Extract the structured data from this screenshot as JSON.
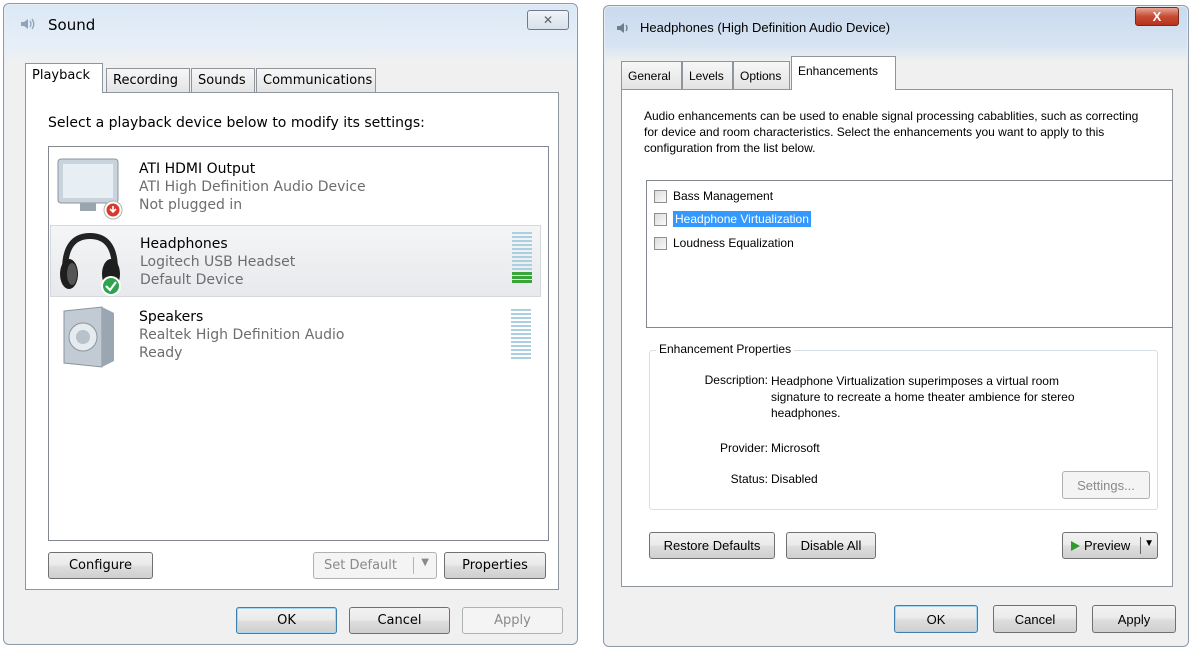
{
  "sound": {
    "title": "Sound",
    "close": "✕",
    "tabs": [
      "Playback",
      "Recording",
      "Sounds",
      "Communications"
    ],
    "instruction": "Select a playback device below to modify its settings:",
    "devices": [
      {
        "name": "ATI HDMI Output",
        "driver": "ATI High Definition Audio Device",
        "status": "Not plugged in"
      },
      {
        "name": "Headphones",
        "driver": "Logitech USB Headset",
        "status": "Default Device"
      },
      {
        "name": "Speakers",
        "driver": "Realtek High Definition Audio",
        "status": "Ready"
      }
    ],
    "buttons": {
      "configure": "Configure",
      "set_default": "Set Default",
      "properties": "Properties",
      "ok": "OK",
      "cancel": "Cancel",
      "apply": "Apply"
    }
  },
  "headphones": {
    "title": "Headphones (High Definition Audio Device)",
    "close": "X",
    "tabs": [
      "General",
      "Levels",
      "Options",
      "Enhancements"
    ],
    "description": "Audio enhancements can be used to enable signal processing cabablities, such as correcting for device and room characteristics. Select the enhancements you want to apply to this configuration from the list below.",
    "enhancements": [
      {
        "label": "Bass Management",
        "checked": false,
        "selected": false
      },
      {
        "label": "Headphone Virtualization",
        "checked": false,
        "selected": true
      },
      {
        "label": "Loudness Equalization",
        "checked": false,
        "selected": false
      }
    ],
    "properties": {
      "group_title": "Enhancement Properties",
      "description_label": "Description:",
      "description_value": "Headphone Virtualization superimposes a virtual room signature to recreate a home theater ambience for stereo headphones.",
      "provider_label": "Provider:",
      "provider_value": "Microsoft",
      "status_label": "Status:",
      "status_value": "Disabled",
      "settings_button": "Settings..."
    },
    "buttons": {
      "restore": "Restore Defaults",
      "disable_all": "Disable All",
      "preview": "Preview",
      "ok": "OK",
      "cancel": "Cancel",
      "apply": "Apply"
    }
  },
  "colors": {
    "accent": "#3399ff",
    "meter_active": "#3aa63a",
    "meter_idle": "#a9cfe0",
    "close_red": "#c64c32"
  }
}
